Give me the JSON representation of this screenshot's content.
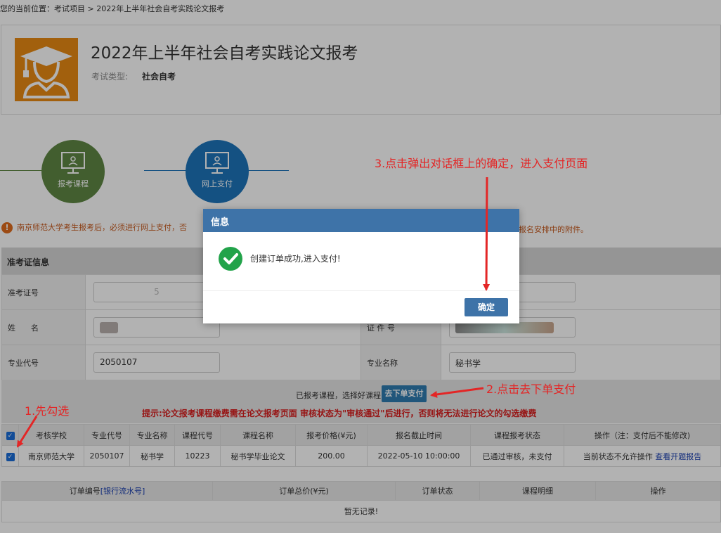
{
  "breadcrumb": "您的当前位置：考试项目 > 2022年上半年社会自考实践论文报考",
  "exam": {
    "title": "2022年上半年社会自考实践论文报考",
    "type_label": "考试类型:",
    "type_value": "社会自考"
  },
  "steps": [
    {
      "label": "报考课程",
      "color": "#5f8744"
    },
    {
      "label": "网上支付",
      "color": "#1d74bb"
    }
  ],
  "notice": {
    "left": "南京师范大学考生报考后，必须进行网上支付，否",
    "right": "报名安排中的附件。"
  },
  "admission": {
    "section_title": "准考证信息",
    "ticket_label": "准考证号",
    "ticket_value": "5",
    "name_label": "姓　　名",
    "id_label": "证 件 号",
    "major_code_label": "专业代号",
    "major_code_value": "2050107",
    "major_name_label": "专业名称",
    "major_name_value": "秘书学"
  },
  "order_bar": {
    "selected_text": "已报考课程，选择好课程",
    "go_button": "去下单支付",
    "tip": "提示:论文报考课程缴费需在论文报考页面 审核状态为\"审核通过\"后进行，否则将无法进行论文的勾选缴费"
  },
  "course_table": {
    "headers": [
      "考核学校",
      "专业代号",
      "专业名称",
      "课程代号",
      "课程名称",
      "报考价格(¥元)",
      "报名截止时间",
      "课程报考状态",
      "操作（注：支付后不能修改)"
    ],
    "row": {
      "school": "南京师范大学",
      "major_code": "2050107",
      "major_name": "秘书学",
      "course_code": "10223",
      "course_name": "秘书学毕业论文",
      "price": "200.00",
      "deadline": "2022-05-10 10:00:00",
      "status": "已通过审核，未支付",
      "op_text": "当前状态不允许操作",
      "op_link": "查看开题报告"
    }
  },
  "orders_table": {
    "h_order_no": "订单编号",
    "h_serial": "[银行流水号]",
    "h_total": "订单总价(¥元)",
    "h_status": "订单状态",
    "h_detail": "课程明细",
    "h_action": "操作",
    "empty": "暂无记录!"
  },
  "dialog": {
    "title": "信息",
    "message": "创建订单成功,进入支付!",
    "ok": "确定"
  },
  "annotations": {
    "a1": "1.先勾选",
    "a2": "2.点击去下单支付",
    "a3": "3.点击弹出对话框上的确定，进入支付页面"
  },
  "colors": {
    "accent": "#3e73a8",
    "annotation": "#e32626",
    "logo": "#e88a14"
  }
}
